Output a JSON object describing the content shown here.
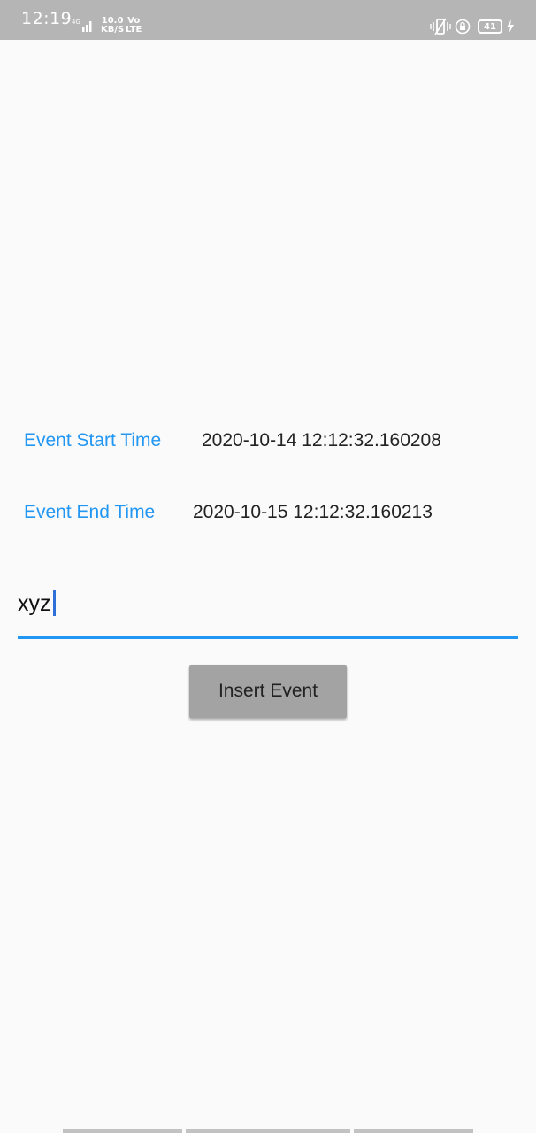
{
  "status_bar": {
    "time": "12:19",
    "net_speed_value": "10.0",
    "net_speed_unit": "KB/S",
    "volte_top": "Vo",
    "volte_bottom": "LTE",
    "battery_level": "41",
    "icons": [
      "signal-icon",
      "vibrate-icon",
      "lock-rotate-icon",
      "battery-icon",
      "charging-icon"
    ],
    "color": "#b5b5b5"
  },
  "event_form": {
    "start_label": "Event Start Time",
    "start_value": "2020-10-14 12:12:32.160208",
    "end_label": "Event End Time",
    "end_value": "2020-10-15 12:12:32.160213",
    "name_input_value": "xyz",
    "insert_button_label": "Insert Event"
  },
  "colors": {
    "accent": "#2196f3",
    "background": "#fafafa",
    "button": "#a3a3a3",
    "text": "#222222"
  }
}
